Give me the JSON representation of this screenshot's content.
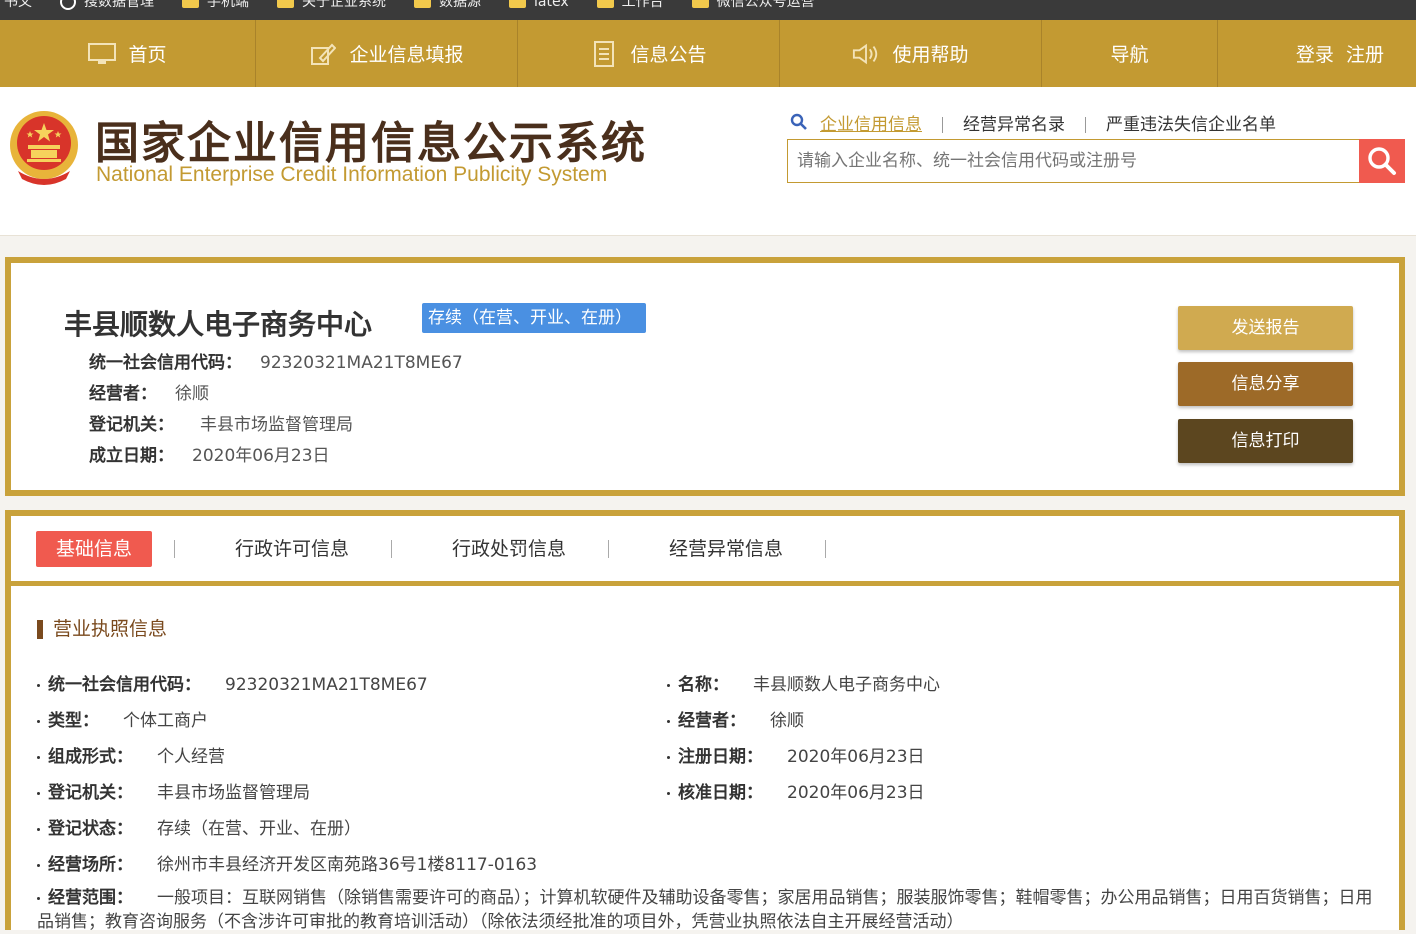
{
  "bookmarks": [
    "书文",
    "搜数据管理",
    "手机端",
    "关于企业系统",
    "数据源",
    "latex",
    "工作台",
    "微信公众号运营"
  ],
  "topnav": {
    "home": "首页",
    "fill": "企业信息填报",
    "notice": "信息公告",
    "help": "使用帮助",
    "guide": "导航",
    "auth": "登录  注册"
  },
  "header": {
    "title": "国家企业信用信息公示系统",
    "subtitle": "National Enterprise Credit Information Publicity System",
    "search_tabs": [
      "企业信用信息",
      "经营异常名录",
      "严重违法失信企业名单"
    ],
    "search_placeholder": "请输入企业名称、统一社会信用代码或注册号"
  },
  "company": {
    "name": "丰县顺数人电子商务中心",
    "status": "存续（在营、开业、在册）",
    "credit_code_label": "统一社会信用代码：",
    "credit_code": "92320321MA21T8ME67",
    "operator_label": "经营者：",
    "operator": "徐顺",
    "authority_label": "登记机关：",
    "authority": "丰县市场监督管理局",
    "founded_label": "成立日期：",
    "founded": "2020年06月23日",
    "btn_report": "发送报告",
    "btn_share": "信息分享",
    "btn_print": "信息打印"
  },
  "tabs": [
    "基础信息",
    "行政许可信息",
    "行政处罚信息",
    "经营异常信息"
  ],
  "license": {
    "section_title": "营业执照信息",
    "fields_left": [
      {
        "label": "统一社会信用代码：",
        "value": "92320321MA21T8ME67"
      },
      {
        "label": "类型：",
        "value": "个体工商户"
      },
      {
        "label": "组成形式：",
        "value": "个人经营"
      },
      {
        "label": "登记机关：",
        "value": "丰县市场监督管理局"
      },
      {
        "label": "登记状态：",
        "value": "存续（在营、开业、在册）"
      },
      {
        "label": "经营场所：",
        "value": "徐州市丰县经济开发区南苑路36号1楼8117-0163"
      },
      {
        "label": "经营范围：",
        "value": "一般项目：互联网销售（除销售需要许可的商品）；计算机软硬件及辅助设备零售；家居用品销售；服装服饰零售；鞋帽零售；办公用品销售；日用百货销售；日用品销售；教育咨询服务（不含涉许可审批的教育培训活动）（除依法须经批准的项目外，凭营业执照依法自主开展经营活动）"
      }
    ],
    "fields_right": [
      {
        "label": "名称：",
        "value": "丰县顺数人电子商务中心"
      },
      {
        "label": "经营者：",
        "value": "徐顺"
      },
      {
        "label": "注册日期：",
        "value": "2020年06月23日"
      },
      {
        "label": "核准日期：",
        "value": "2020年06月23日"
      }
    ]
  },
  "colors": {
    "gold": "#c39a32",
    "red": "#f05a4f",
    "blue": "#4a90e2",
    "brown": "#7a4a1e"
  }
}
